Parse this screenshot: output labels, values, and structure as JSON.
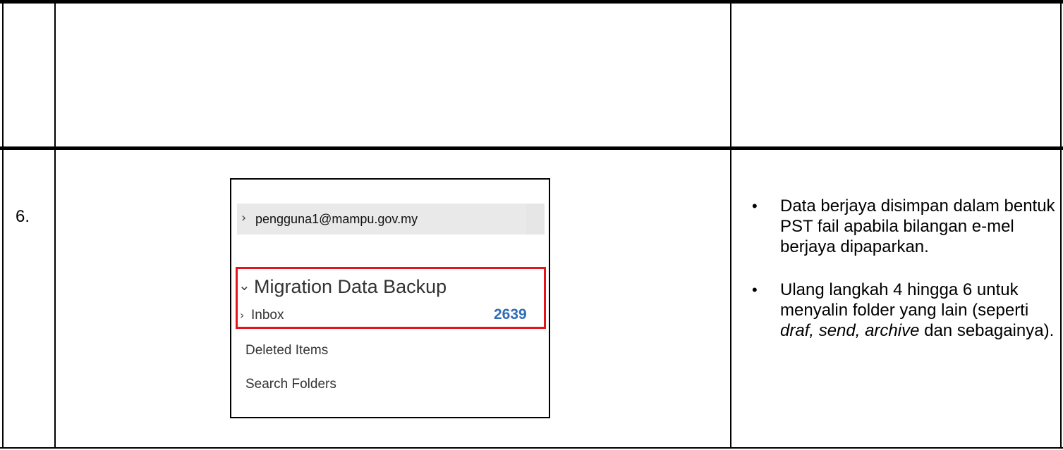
{
  "step": {
    "number": "6."
  },
  "screenshot": {
    "account": {
      "label": "pengguna1@mampu.gov.my",
      "icon": "chevron-right-icon"
    },
    "pst": {
      "label": "Migration Data Backup",
      "icon": "chevron-down-icon",
      "highlight_color": "#e3141a",
      "inbox": {
        "label": "Inbox",
        "count": "2639",
        "count_color": "#2f6db5",
        "icon": "chevron-right-icon"
      }
    },
    "folders": [
      {
        "label": "Deleted Items"
      },
      {
        "label": "Search Folders"
      }
    ]
  },
  "notes": [
    {
      "text": "Data berjaya disimpan dalam bentuk PST fail apabila bilangan e-mel berjaya dipaparkan."
    },
    {
      "text_before": "Ulang langkah 4 hingga 6 untuk menyalin folder yang lain (seperti ",
      "italic_1": "draf, send, archive",
      "text_after": " dan sebagainya)."
    }
  ]
}
